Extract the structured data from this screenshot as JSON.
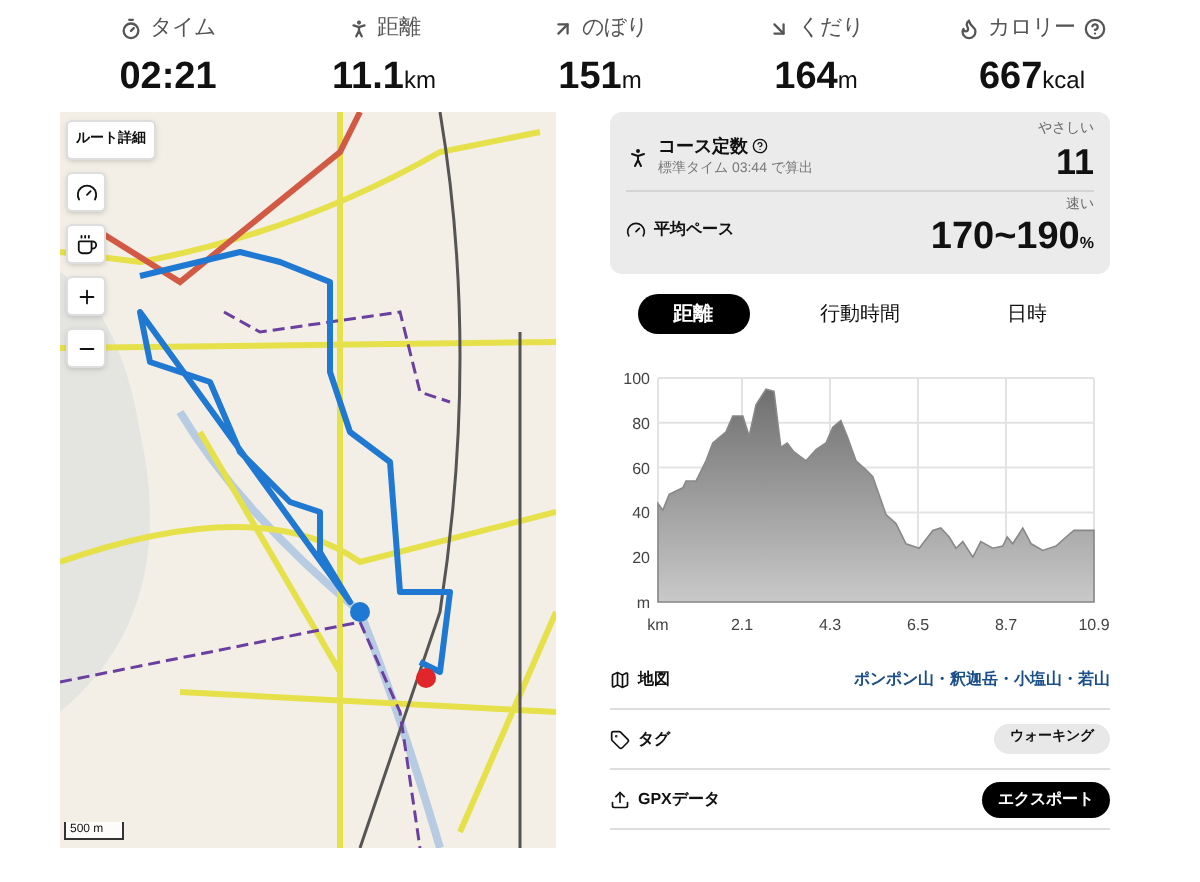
{
  "stats": [
    {
      "label": "タイム",
      "value": "02:21",
      "help": false
    },
    {
      "label": "距離",
      "value": "11.1",
      "unit": "km",
      "help": false
    },
    {
      "label": "のぼり",
      "value": "151",
      "unit": "m",
      "help": false
    },
    {
      "label": "くだり",
      "value": "164",
      "unit": "m",
      "help": false
    },
    {
      "label": "カロリー",
      "value": "667",
      "unit": "kcal",
      "help": true
    }
  ],
  "map": {
    "route_button": "ルート詳細",
    "scale": "500 m"
  },
  "course_card": {
    "title": "コース定数",
    "subtitle": "標準タイム 03:44 で算出",
    "rating": "やさしい",
    "value": "11"
  },
  "pace": {
    "title": "平均ペース",
    "rating": "速い",
    "value": "170~190",
    "unit": "%"
  },
  "tabs": [
    {
      "label": "距離",
      "selected": true
    },
    {
      "label": "行動時間",
      "selected": false
    },
    {
      "label": "日時",
      "selected": false
    }
  ],
  "elevation_chart": {
    "chart_data": {
      "type": "area",
      "x": [
        0,
        0.12,
        0.28,
        0.62,
        0.7,
        0.95,
        1.2,
        1.37,
        1.7,
        1.87,
        2.12,
        2.28,
        2.45,
        2.7,
        2.9,
        3.07,
        3.23,
        3.4,
        3.7,
        3.95,
        4.2,
        4.37,
        4.57,
        4.73,
        4.95,
        5.2,
        5.37,
        5.7,
        5.95,
        6.2,
        6.53,
        6.87,
        7.07,
        7.28,
        7.45,
        7.62,
        7.87,
        8.07,
        8.37,
        8.62,
        8.73,
        8.87,
        9.12,
        9.33,
        9.62,
        9.95,
        10.2,
        10.4,
        10.9
      ],
      "grid": true,
      "series": [
        {
          "color": "#888888",
          "values": [
            44,
            41,
            48,
            51,
            54,
            54,
            63,
            71,
            76,
            83,
            83,
            74,
            88,
            95,
            94,
            69,
            71,
            67,
            63,
            68,
            71,
            78,
            81,
            74,
            63,
            59,
            56,
            39,
            35,
            26,
            24,
            32,
            33,
            29,
            24,
            27,
            20,
            27,
            24,
            25,
            29,
            26,
            33,
            26,
            23,
            25,
            29,
            32,
            32
          ]
        }
      ],
      "xlim": [
        0,
        10.9
      ],
      "ylim": [
        0,
        100
      ],
      "xticks": [
        {
          "value": 0,
          "label": "km"
        },
        2.1,
        4.3,
        6.5,
        8.7,
        10.9
      ],
      "yticks": [
        {
          "value": 0,
          "label": "m"
        },
        20,
        40,
        60,
        80,
        100
      ]
    }
  },
  "info_rows": [
    {
      "kind": "link",
      "label": "地図",
      "value": "ポンポン山・釈迦岳・小塩山・若山"
    },
    {
      "kind": "chip",
      "label": "タグ",
      "value": "ウォーキング"
    },
    {
      "kind": "button",
      "label": "GPXデータ",
      "value": "エクスポート"
    }
  ]
}
